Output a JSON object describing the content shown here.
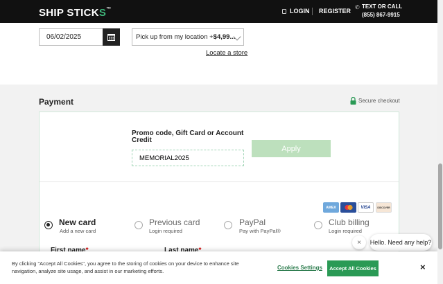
{
  "header": {
    "logo_main": "SHIP STICK",
    "logo_accent": "S",
    "logo_tm": "™",
    "login": "LOGIN",
    "register": "REGISTER",
    "contact_label": "TEXT OR CALL",
    "contact_phone": "(855) 867-9915"
  },
  "shipping": {
    "date_value": "06/02/2025",
    "pickup_text": "Pick up from my location +",
    "pickup_price": "$4,99...",
    "locate_store": "Locate a store"
  },
  "payment": {
    "title": "Payment",
    "secure_label": "Secure checkout",
    "promo_label": "Promo code, Gift Card or Account Credit",
    "promo_value": "MEMORIAL2025",
    "apply_label": "Apply",
    "card_brands": [
      "AMEX",
      "MC",
      "VISA",
      "DISCOVER"
    ],
    "options": [
      {
        "title": "New card",
        "sub": "Add a new card",
        "selected": true
      },
      {
        "title": "Previous card",
        "sub": "Login required",
        "selected": false
      },
      {
        "title": "PayPal",
        "sub": "Pay with PayPal®",
        "selected": false
      },
      {
        "title": "Club billing",
        "sub": "Login required",
        "selected": false
      }
    ],
    "first_name_label": "First name",
    "last_name_label": "Last name",
    "required_mark": "*"
  },
  "chat": {
    "close": "×",
    "message": "Hello. Need any help?"
  },
  "cookie": {
    "text": "By clicking \"Accept All Cookies\", you agree to the storing of cookies on your device to enhance site navigation, analyze site usage, and assist in our marketing efforts.",
    "settings_label": "Cookies Settings",
    "accept_label": "Accept All Cookies",
    "close": "×"
  },
  "colors": {
    "header_bg": "#111111",
    "accent_green": "#2a9a55",
    "apply_disabled": "#bde0bd"
  }
}
